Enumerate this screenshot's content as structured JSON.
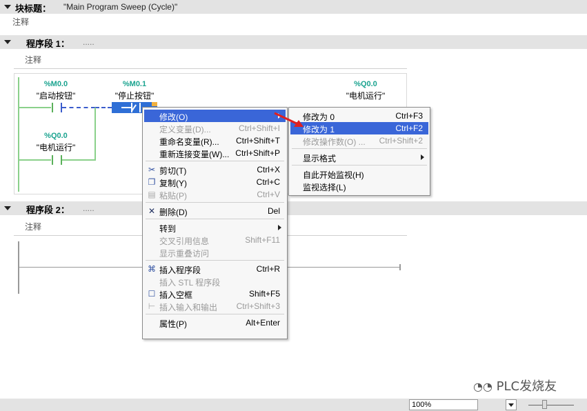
{
  "block": {
    "title_label": "块标题：",
    "title_value": "\"Main Program Sweep (Cycle)\"",
    "comment": "注释"
  },
  "network1": {
    "label": "程序段 1：",
    "dots": ".....",
    "comment": "注释",
    "contacts": [
      {
        "addr": "%M0.0",
        "name": "\"启动按钮\""
      },
      {
        "addr": "%M0.1",
        "name": "\"停止按钮\""
      },
      {
        "addr": "%Q0.0",
        "name": "\"电机运行\""
      }
    ],
    "coil": {
      "addr": "%Q0.0",
      "name": "\"电机运行\""
    }
  },
  "network2": {
    "label": "程序段 2：",
    "dots": ".....",
    "comment": "注释"
  },
  "context_menu": {
    "items": [
      {
        "label": "修改(O)",
        "shortcut": "",
        "disabled": false,
        "highlight": true,
        "submenu": true,
        "icon": ""
      },
      {
        "label": "定义变量(D)...",
        "shortcut": "Ctrl+Shift+I",
        "disabled": true,
        "icon": ""
      },
      {
        "label": "重命名变量(R)...",
        "shortcut": "Ctrl+Shift+T",
        "disabled": false,
        "icon": ""
      },
      {
        "label": "重新连接变量(W)...",
        "shortcut": "Ctrl+Shift+P",
        "disabled": false,
        "icon": ""
      },
      {
        "label": "剪切(T)",
        "shortcut": "Ctrl+X",
        "disabled": false,
        "icon": "scissors-icon"
      },
      {
        "label": "复制(Y)",
        "shortcut": "Ctrl+C",
        "disabled": false,
        "icon": "copy-icon"
      },
      {
        "label": "粘贴(P)",
        "shortcut": "Ctrl+V",
        "disabled": true,
        "icon": "paste-icon"
      },
      {
        "label": "删除(D)",
        "shortcut": "Del",
        "disabled": false,
        "icon": "delete-icon"
      },
      {
        "label": "转到",
        "shortcut": "",
        "disabled": false,
        "submenu": true,
        "icon": ""
      },
      {
        "label": "交叉引用信息",
        "shortcut": "Shift+F11",
        "disabled": true,
        "icon": ""
      },
      {
        "label": "显示重叠访问",
        "shortcut": "",
        "disabled": true,
        "icon": ""
      },
      {
        "label": "插入程序段",
        "shortcut": "Ctrl+R",
        "disabled": false,
        "icon": "insert-network-icon"
      },
      {
        "label": "插入 STL 程序段",
        "shortcut": "",
        "disabled": true,
        "icon": ""
      },
      {
        "label": "插入空框",
        "shortcut": "Shift+F5",
        "disabled": false,
        "icon": "empty-box-icon"
      },
      {
        "label": "插入输入和输出",
        "shortcut": "Ctrl+Shift+3",
        "disabled": true,
        "icon": "insert-io-icon"
      },
      {
        "label": "属性(P)",
        "shortcut": "Alt+Enter",
        "disabled": false,
        "icon": ""
      }
    ]
  },
  "submenu": {
    "items": [
      {
        "label": "修改为 0",
        "shortcut": "Ctrl+F3",
        "disabled": false,
        "highlight": false
      },
      {
        "label": "修改为 1",
        "shortcut": "Ctrl+F2",
        "disabled": false,
        "highlight": true
      },
      {
        "label": "修改操作数(O) ...",
        "shortcut": "Ctrl+Shift+2",
        "disabled": true,
        "highlight": false
      },
      {
        "label": "显示格式",
        "shortcut": "",
        "disabled": false,
        "submenu": true
      },
      {
        "label": "自此开始监视(H)",
        "shortcut": "",
        "disabled": false
      },
      {
        "label": "监视选择(L)",
        "shortcut": "",
        "disabled": false
      }
    ]
  },
  "status": {
    "zoom": "100%"
  },
  "watermark": "PLC发烧友",
  "colors": {
    "tag_addr": "#1aa38f",
    "highlight": "#3a66d8",
    "arrow": "#e02020"
  }
}
